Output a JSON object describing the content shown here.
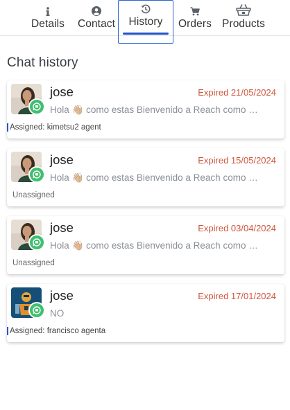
{
  "tabs": [
    {
      "label": "Details",
      "icon": "info-icon"
    },
    {
      "label": "Contact",
      "icon": "user-icon"
    },
    {
      "label": "History",
      "icon": "history-icon",
      "active": true
    },
    {
      "label": "Orders",
      "icon": "cart-icon"
    },
    {
      "label": "Products",
      "icon": "basket-icon"
    }
  ],
  "section_title": "Chat history",
  "chats": [
    {
      "name": "jose",
      "status": "Expired 21/05/2024",
      "message": "Hola 👋🏼 como estas Bienvenido a Reach como podemos ayudarte hoy?",
      "assignment": "Assigned: kimetsu2 agent",
      "assigned": true,
      "avatar": "woman-photo",
      "channel": "whatsapp-icon"
    },
    {
      "name": "jose",
      "status": "Expired 15/05/2024",
      "message": "Hola 👋🏼 como estas Bienvenido a Reach como podemos ayudarte hoy?",
      "assignment": "Unassigned",
      "assigned": false,
      "avatar": "woman-photo",
      "channel": "whatsapp-icon"
    },
    {
      "name": "jose",
      "status": "Expired 03/04/2024",
      "message": "Hola 👋🏼 como estas Bienvenido a Reach como podemos ayudarte hoy?",
      "assignment": "Unassigned",
      "assigned": false,
      "avatar": "woman-photo",
      "channel": "whatsapp-icon"
    },
    {
      "name": "jose",
      "status": "Expired 17/01/2024",
      "message": "NO",
      "assignment": "Assigned: francisco agenta",
      "assigned": true,
      "avatar": "robot-photo",
      "channel": "whatsapp-icon"
    }
  ],
  "colors": {
    "accent": "#1e52c9",
    "expired": "#d0553c",
    "whatsapp": "#3fbf6f"
  }
}
